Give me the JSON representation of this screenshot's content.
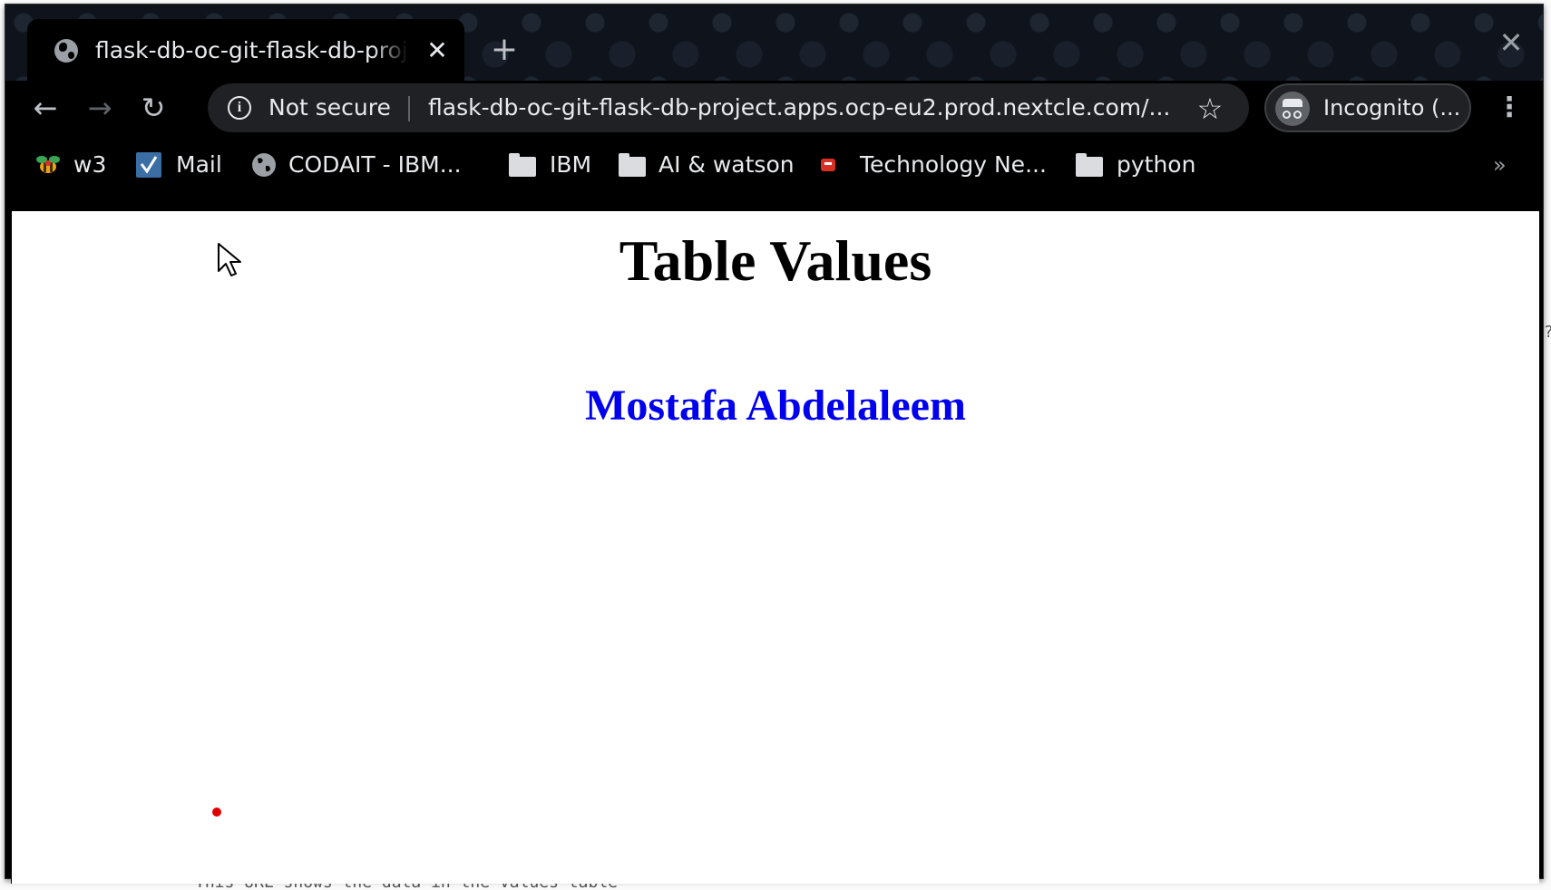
{
  "browser": {
    "tab": {
      "title": "flask-db-oc-git-flask-db-project"
    },
    "omnibox": {
      "security_label": "Not secure",
      "url": "flask-db-oc-git-flask-db-project.apps.ocp-eu2.prod.nextcle.com/..."
    },
    "profile_label": "Incognito (...",
    "bookmarks": [
      {
        "label": "w3",
        "icon": "w3-bee-icon"
      },
      {
        "label": "Mail",
        "icon": "mail-check-icon"
      },
      {
        "label": "CODAIT - IBM...",
        "icon": "globe-icon"
      },
      {
        "label": "IBM",
        "icon": "folder-icon"
      },
      {
        "label": "AI & watson",
        "icon": "folder-icon"
      },
      {
        "label": "Technology Ne...",
        "icon": "news-icon"
      },
      {
        "label": "python",
        "icon": "folder-icon"
      }
    ],
    "bookmarks_overflow": "»"
  },
  "page": {
    "heading": "Table Values",
    "rows": [
      {
        "value": "Mostafa Abdelaleem"
      }
    ]
  },
  "background": {
    "editor_bottom_text": "This URL shows the data in the values table",
    "editor_right_text": "?"
  },
  "colors": {
    "link_blue": "#0000ee",
    "chrome_dark": "#000000",
    "omnibox_bg": "#202124",
    "recording_dot": "#e00000"
  }
}
